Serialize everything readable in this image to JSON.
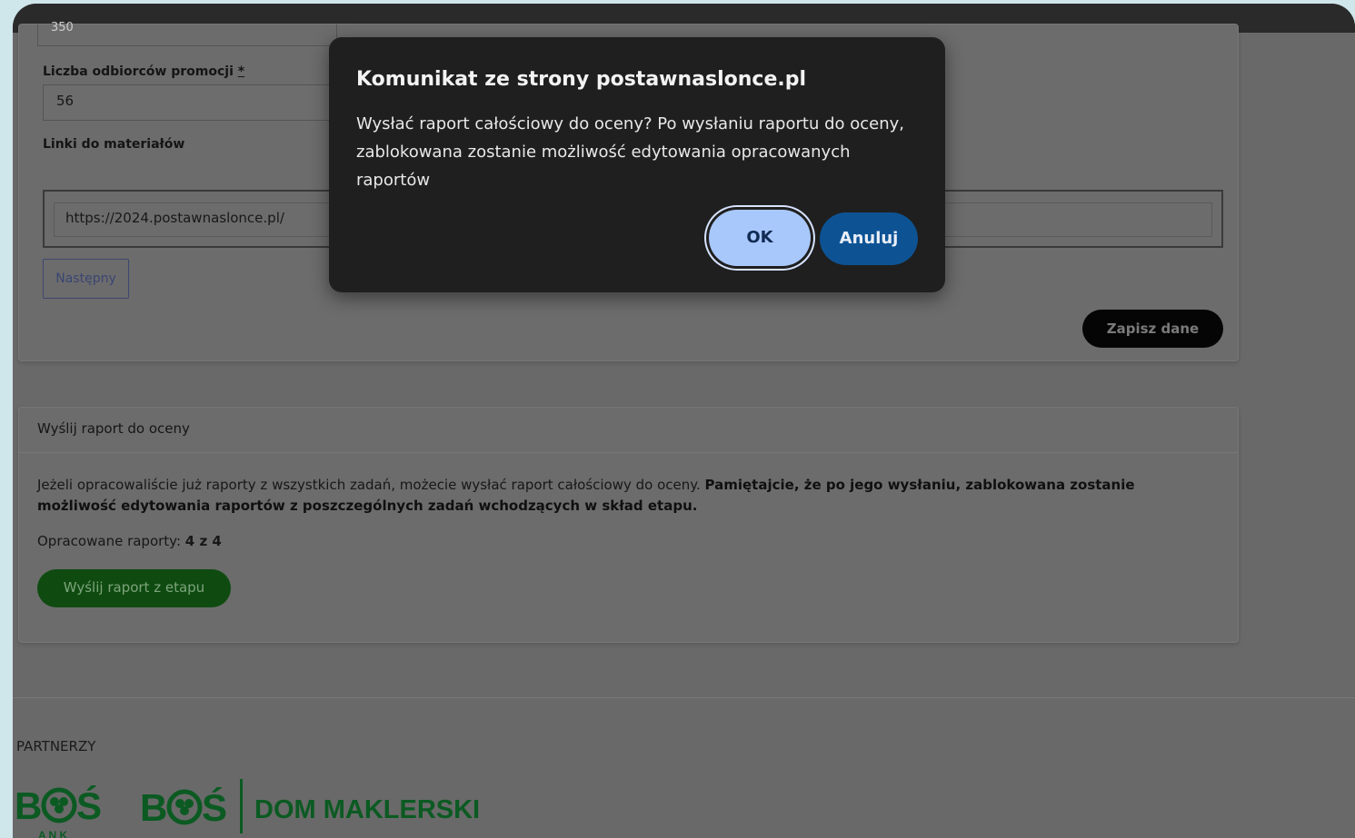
{
  "form": {
    "top_value": "350",
    "recipients_label": "Liczba odbiorców promocji ",
    "required_mark": "*",
    "recipients_value": "56",
    "links_label": "Linki do materiałów",
    "links_value": "https://2024.postawnaslonce.pl/",
    "next_button": "Następny",
    "save_button": "Zapisz dane"
  },
  "report_card": {
    "header": "Wyślij raport do oceny",
    "text_plain": "Jeżeli opracowaliście już raporty z wszystkich zadań, możecie wysłać raport całościowy do oceny. ",
    "text_bold": "Pamiętajcie, że po jego wysłaniu, zablokowana zostanie możliwość edytowania raportów z poszczególnych zadań wchodzących w skład etapu.",
    "count_label": "Opracowane raporty: ",
    "count_value": "4 z 4",
    "send_button": "Wyślij raport z etapu"
  },
  "footer": {
    "partners_label": "PARTNERZY",
    "logo_bos_text": "BOŚ",
    "logo_bank_text": "A N K",
    "logo_dm_text": "DOM MAKLERSKI"
  },
  "dialog": {
    "title": "Komunikat ze strony postawnaslonce.pl",
    "message": "Wysłać raport całościowy do oceny? Po wysłaniu raportu do oceny, zablokowana zostanie możliwość edytowania opracowanych raportów",
    "ok_button": "OK",
    "cancel_button": "Anuluj"
  },
  "colors": {
    "overlay_background": "#696969",
    "dialog_background": "#1f1f1f",
    "ok_button": "#a8c8fb",
    "cancel_button": "#0d5394",
    "logo_green": "#0b5a22"
  }
}
